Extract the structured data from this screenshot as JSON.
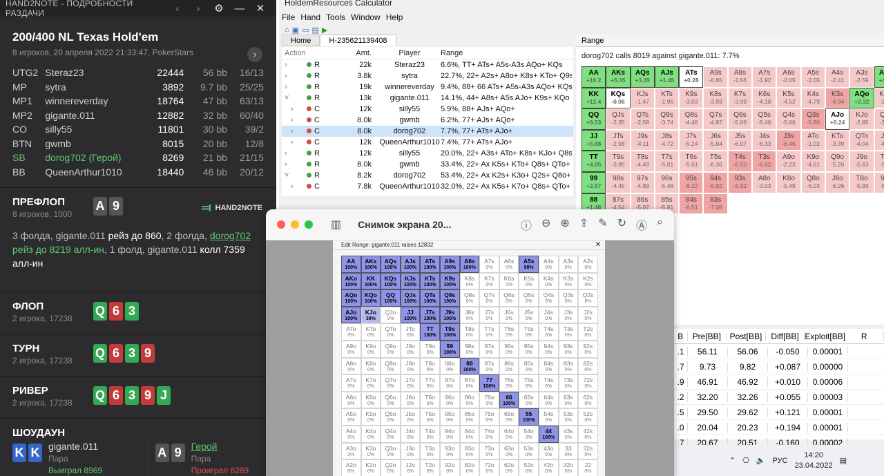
{
  "h2n": {
    "title": "HAND2NOTE - ПОДРОБНОСТИ РАЗДАЧИ",
    "game": "200/400 NL Texas Hold'em",
    "sub": "8 игроков, 20 апреля 2022 21:33:47, PokerStars",
    "players": [
      {
        "pos": "UTG2",
        "name": "Steraz23",
        "stack": "22444",
        "bb": "56 bb",
        "vp": "16/13"
      },
      {
        "pos": "MP",
        "name": "sytra",
        "stack": "3892",
        "bb": "9.7 bb",
        "vp": "25/25"
      },
      {
        "pos": "MP1",
        "name": "winnereverday",
        "stack": "18764",
        "bb": "47 bb",
        "vp": "63/13"
      },
      {
        "pos": "MP2",
        "name": "gigante.011",
        "stack": "12882",
        "bb": "32 bb",
        "vp": "60/40"
      },
      {
        "pos": "CO",
        "name": "silly55",
        "stack": "11801",
        "bb": "30 bb",
        "vp": "39/2"
      },
      {
        "pos": "BTN",
        "name": "gwmb",
        "stack": "8015",
        "bb": "20 bb",
        "vp": "12/8"
      },
      {
        "pos": "SB",
        "name": "dorog702 (Герой)",
        "stack": "8269",
        "bb": "21 bb",
        "vp": "21/15"
      },
      {
        "pos": "BB",
        "name": "QueenArthur1010",
        "stack": "18440",
        "bb": "46 bb",
        "vp": "20/12"
      }
    ],
    "preflop": {
      "t": "ПРЕФЛОП",
      "s": "8 игроков, 1000",
      "c1": "A",
      "c2": "9",
      "a1": "3 фолда, gigante.011 ",
      "a2": "рейз до 860",
      "a3": ", 2 фолда, ",
      "a4": "dorog702",
      "a5": " рейз до 8219 алл-ин",
      "a6": ", 1 фолд, gigante.011 ",
      "a7": "колл 7359 алл-ин"
    },
    "logo": "HAND2NOTE",
    "flop": {
      "t": "ФЛОП",
      "s": "2 игрока, 17238",
      "c": [
        "Q",
        "6",
        "3"
      ]
    },
    "turn": {
      "t": "ТУРН",
      "s": "2 игрока, 17238",
      "c": [
        "Q",
        "6",
        "3",
        "9"
      ]
    },
    "river": {
      "t": "РИВЕР",
      "s": "2 игрока, 17238",
      "c": [
        "Q",
        "6",
        "3",
        "9",
        "J"
      ]
    },
    "show": {
      "t": "ШОУДАУН",
      "p1": {
        "c1": "K",
        "c2": "K",
        "n": "gigante.011",
        "h": "Пара",
        "r": "Выиграл 8969"
      },
      "p2": {
        "c1": "A",
        "c2": "9",
        "n": "Герой",
        "h": "Пара",
        "r": "Проиграл 8269"
      }
    }
  },
  "hr": {
    "title": "HoldemResources Calculator",
    "menu": [
      "File",
      "Hand",
      "Tools",
      "Window",
      "Help"
    ],
    "tab_home": "Home",
    "tab_h": "H-235621139408",
    "cols": [
      "Action",
      "Amt.",
      "Player",
      "Range"
    ],
    "rows": [
      {
        "a": "R",
        "d": "g",
        "amt": "22k",
        "p": "Steraz23",
        "r": "6.6%, TT+ ATs+ A5s-A3s AQo+ KQs"
      },
      {
        "a": "R",
        "d": "g",
        "amt": "3.8k",
        "p": "sytra",
        "r": "22.7%, 22+ A2s+ A8o+ K8s+ KTo+ Q9s"
      },
      {
        "a": "R",
        "d": "g",
        "amt": "19k",
        "p": "winnereverday",
        "r": "9.4%, 88+ 66 ATs+ A5s-A3s AQo+ KQs+"
      },
      {
        "a": "R",
        "d": "g",
        "amt": "13k",
        "p": "gigante.011",
        "r": "14.1%, 44+ A8s+ A5s AJo+ K9s+ KQo"
      },
      {
        "a": "C",
        "d": "r",
        "amt": "12k",
        "p": "silly55",
        "r": "5.9%, 88+ AJs+ AQo+"
      },
      {
        "a": "C",
        "d": "r",
        "amt": "8.0k",
        "p": "gwmb",
        "r": "6.2%, 77+ AJs+ AQo+"
      },
      {
        "a": "C",
        "d": "r",
        "amt": "8.0k",
        "p": "dorog702",
        "r": "7.7%, 77+ ATs+ AJo+"
      },
      {
        "a": "C",
        "d": "r",
        "amt": "12k",
        "p": "QueenArthur1010",
        "r": "7.4%, 77+ ATs+ AJo+"
      },
      {
        "a": "R",
        "d": "g",
        "amt": "12k",
        "p": "silly55",
        "r": "20.0%, 22+ A3s+ ATo+ K8s+ KJo+ Q8s"
      },
      {
        "a": "R",
        "d": "g",
        "amt": "8.0k",
        "p": "gwmb",
        "r": "33.4%, 22+ Ax K5s+ KTo+ Q8s+ QTo+"
      },
      {
        "a": "R",
        "d": "g",
        "amt": "8.2k",
        "p": "dorog702",
        "r": "53.4%, 22+ Ax K2s+ K3o+ Q2s+ Q8o+"
      },
      {
        "a": "C",
        "d": "r",
        "amt": "7.8k",
        "p": "QueenArthur1010",
        "r": "32.0%, 22+ Ax K5s+ K7o+ Q8s+ QTo+"
      }
    ],
    "range_tab": "Range",
    "range_cap": "dorog702 calls 8019 against gigante.011: 7.7%",
    "grid": [
      [
        "AA|+16.2|p",
        "AKs|+5.35|p",
        "AQs|+3.39|p",
        "AJs|+1.45|p",
        "ATs|+0.28|w",
        "A9s|-0.85|m",
        "A8s|-1.56|m",
        "A7s|-1.92|m",
        "A6s|-2.05|m",
        "A5s|-2.05|m",
        "A4s|-2.41|m",
        "A3s|-2.59|m"
      ],
      [
        "AKo|+4.42|p",
        "KK|+12.4|p",
        "KQs|-0.06|w",
        "KJs|-1.47|m",
        "KTs|-1.96|m",
        "K9s|-3.03|m",
        "K8s|-3.93|m",
        "K7s|-3.99|m",
        "K6s|-4.18|m",
        "K5s|-4.52|m",
        "K4s|-4.79|m",
        "K3s|-4.94|d"
      ],
      [
        "AQo|+2.32|p",
        "KQo|-1.32|m",
        "QQ|+9.53|p",
        "QJs|-2.35|m",
        "QTs|-2.59|m",
        "Q9s|-3.74|m",
        "Q8s|-4.48|m",
        "Q7s|-4.97|m",
        "Q6s|-5.06|m",
        "Q5s|-5.40|m",
        "Q4s|-5.66|m",
        "Q3s|-5.80|d"
      ],
      [
        "AJo|+0.24|w",
        "KJo|-2.85|m",
        "QJo|-3.80|m",
        "JJ|+6.88|p",
        "JTs|-2.98|m",
        "J9s|-4.11|m",
        "J8s|-4.72|m",
        "J7s|-5.24|m",
        "J6s|-5.84|m",
        "J5s|-6.07|m",
        "J4s|-6.33|m",
        "J3s|-6.46|d"
      ],
      [
        "ATo|-1.02|m",
        "KTo|-3.39|m",
        "QTo|-4.04|m",
        "JTo|-4.42|m",
        "TT|+4.85|p",
        "T9s|-3.95|m",
        "T8s|-4.49|m",
        "T7s|-5.01|m",
        "T6s|-5.61|m",
        "T5s|-6.36|m",
        "T4s|-6.50|d",
        "T3s|-6.62|d"
      ],
      [
        "A9o|-2.23|m",
        "K9o|-4.61|m",
        "Q9o|-5.26|m",
        "J9o|-5.63|m",
        "T9o|-5.46|m",
        "99|+2.87|p",
        "98s|-4.45|m",
        "97s|-4.89|m",
        "96s|-5.46|m",
        "95s|-6.22|d",
        "94s|-6.92|d",
        "93s|-6.92|d"
      ],
      [
        "A8o|-3.03|m",
        "K8o|-5.49|m",
        "Q8o|-6.03|m",
        "J8o|-6.26|m",
        "T8o|-5.99|m",
        "98o|-5.94|m",
        "88|+1.46|p",
        "87s|-4.54|m",
        "86s|-5.07|m",
        "85s|-5.81|m",
        "84s|-6.51|d",
        "83s|-7.08|d"
      ]
    ],
    "stats_cols": [
      "B",
      "Pre[BB]",
      "Post[BB]",
      "Diff[BB]",
      "Exploit[BB]",
      "R"
    ],
    "stats": [
      [
        ".1",
        "56.11",
        "56.06",
        "-0.050",
        "0.00001"
      ],
      [
        ".7",
        "9.73",
        "9.82",
        "+0.087",
        "0.00000"
      ],
      [
        ".9",
        "46.91",
        "46.92",
        "+0.010",
        "0.00006"
      ],
      [
        ".2",
        "32.20",
        "32.26",
        "+0.055",
        "0.00003"
      ],
      [
        ".5",
        "29.50",
        "29.62",
        "+0.121",
        "0.00001"
      ],
      [
        ".0",
        "20.04",
        "20.23",
        "+0.194",
        "0.00001"
      ],
      [
        ".7",
        "20.67",
        "20.51",
        "-0.160",
        "0.00002"
      ],
      [
        ".1",
        "46.10",
        "45.84",
        "-0.257",
        "0.00003"
      ]
    ],
    "lang": "РУС",
    "time": "14:20",
    "date": "23.04.2022"
  },
  "mac": {
    "title": "Снимок экрана 20...",
    "er_title": "Edit Range: gigante.011 raises 12832",
    "grid": [
      [
        "AA|100%|f",
        "AKs|100%|f",
        "AQs|100%|f",
        "AJs|100%|f",
        "ATs|100%|f",
        "A9s|100%|f",
        "A8s|100%|f",
        "A7s|0%|",
        "A6s|0%|",
        "A5s|98%|f",
        "A4s|0%|",
        "A3s|0%|",
        "A2s|0%|"
      ],
      [
        "AKo|100%|f",
        "KK|100%|f",
        "KQs|100%|f",
        "KJs|100%|f",
        "KTs|100%|f",
        "K9s|100%|f",
        "K8s|0%|",
        "K7s|0%|",
        "K6s|0%|",
        "K5s|0%|",
        "K4s|0%|",
        "K3s|0%|",
        "K2s|0%|"
      ],
      [
        "AQo|100%|f",
        "KQo|100%|f",
        "QQ|100%|f",
        "QJs|100%|f",
        "QTs|100%|f",
        "Q9s|100%|f",
        "Q8s|0%|",
        "Q7s|0%|",
        "Q6s|0%|",
        "Q5s|0%|",
        "Q4s|0%|",
        "Q3s|0%|",
        "Q2s|0%|"
      ],
      [
        "AJo|100%|f",
        "KJo|39%|pt",
        "QJo|0%|",
        "JJ|100%|f",
        "JTs|100%|f",
        "J9s|100%|f",
        "J8s|0%|",
        "J7s|0%|",
        "J6s|0%|",
        "J5s|0%|",
        "J4s|0%|",
        "J3s|0%|",
        "J2s|0%|"
      ],
      [
        "ATo|0%|",
        "KTo|0%|",
        "QTo|0%|",
        "JTo|0%|",
        "TT|100%|f",
        "T9s|100%|f",
        "T8s|0%|",
        "T7s|0%|",
        "T6s|0%|",
        "T5s|0%|",
        "T4s|0%|",
        "T3s|0%|",
        "T2s|0%|"
      ],
      [
        "A9o|0%|",
        "K9o|0%|",
        "Q9o|0%|",
        "J9o|0%|",
        "T9o|0%|",
        "99|100%|f",
        "98s|0%|",
        "97s|0%|",
        "96s|0%|",
        "95s|0%|",
        "94s|0%|",
        "93s|0%|",
        "92s|0%|"
      ],
      [
        "A8o|0%|",
        "K8o|0%|",
        "Q8o|0%|",
        "J8o|0%|",
        "T8o|0%|",
        "98o|0%|",
        "88|100%|f",
        "87s|0%|",
        "86s|0%|",
        "85s|0%|",
        "84s|0%|",
        "83s|0%|",
        "82s|0%|"
      ],
      [
        "A7o|0%|",
        "K7o|0%|",
        "Q7o|0%|",
        "J7o|0%|",
        "T7o|0%|",
        "97o|0%|",
        "87o|0%|",
        "77|100%|f",
        "76s|0%|",
        "75s|0%|",
        "74s|0%|",
        "73s|0%|",
        "72s|0%|"
      ],
      [
        "A6o|0%|",
        "K6o|0%|",
        "Q6o|0%|",
        "J6o|0%|",
        "T6o|0%|",
        "96o|0%|",
        "86o|0%|",
        "76o|0%|",
        "66|100%|f",
        "65s|0%|",
        "64s|0%|",
        "63s|0%|",
        "62s|0%|"
      ],
      [
        "A5o|0%|",
        "K5o|0%|",
        "Q5o|0%|",
        "J5o|0%|",
        "T5o|0%|",
        "95o|0%|",
        "85o|0%|",
        "75o|0%|",
        "65o|0%|",
        "55|100%|f",
        "54s|0%|",
        "53s|0%|",
        "52s|0%|"
      ],
      [
        "A4o|0%|",
        "K4o|0%|",
        "Q4o|0%|",
        "J4o|0%|",
        "T4o|0%|",
        "94o|0%|",
        "84o|0%|",
        "74o|0%|",
        "64o|0%|",
        "54o|0%|",
        "44|100%|f",
        "43s|0%|",
        "42s|0%|"
      ],
      [
        "A3o|0%|",
        "K3o|0%|",
        "Q3o|0%|",
        "J3o|0%|",
        "T3o|0%|",
        "93o|0%|",
        "83o|0%|",
        "73o|0%|",
        "63o|0%|",
        "53o|0%|",
        "43o|0%|",
        "33|0%|",
        "32s|0%|"
      ],
      [
        "A2o|0%|",
        "K2o|0%|",
        "Q2o|0%|",
        "J2o|0%|",
        "T2o|0%|",
        "92o|0%|",
        "82o|0%|",
        "72o|0%|",
        "62o|0%|",
        "52o|0%|",
        "42o|0%|",
        "32o|0%|",
        "22|0%|"
      ]
    ]
  }
}
